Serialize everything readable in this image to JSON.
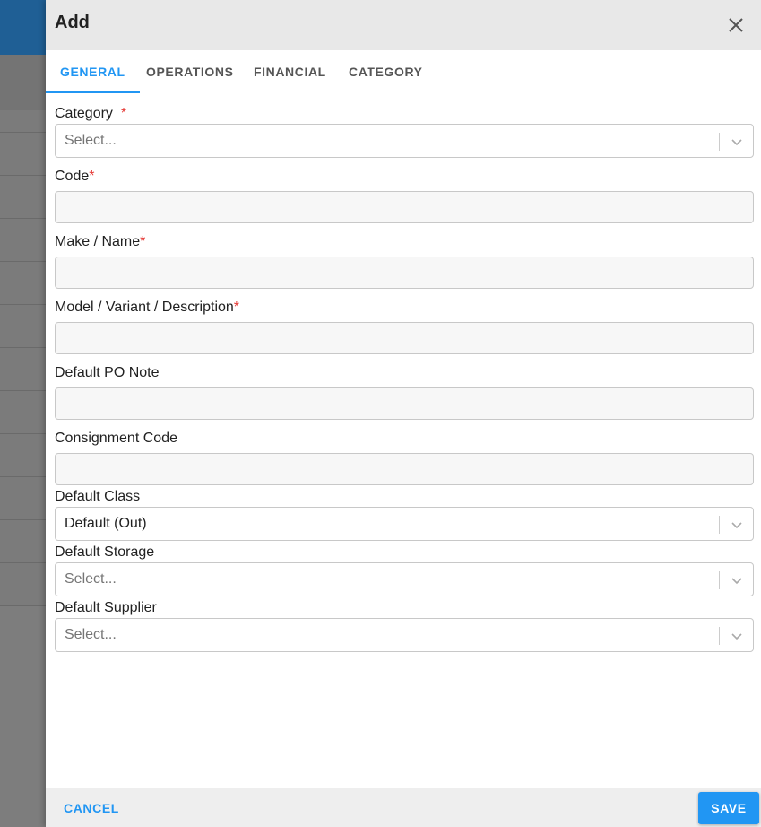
{
  "dialog": {
    "title": "Add"
  },
  "tabs": [
    {
      "label": "GENERAL",
      "active": true
    },
    {
      "label": "OPERATIONS",
      "active": false
    },
    {
      "label": "FINANCIAL",
      "active": false
    },
    {
      "label": "CATEGORY",
      "active": false
    }
  ],
  "form": {
    "category": {
      "label": "Category",
      "required_mark": "*",
      "placeholder": "Select..."
    },
    "code": {
      "label": "Code",
      "required_mark": "*",
      "value": ""
    },
    "make_name": {
      "label": "Make / Name",
      "required_mark": "*",
      "value": ""
    },
    "model": {
      "label": "Model / Variant / Description",
      "required_mark": "*",
      "value": ""
    },
    "po_note": {
      "label": "Default PO Note",
      "value": ""
    },
    "consignment": {
      "label": "Consignment Code",
      "value": ""
    },
    "default_class": {
      "label": "Default Class",
      "value": "Default (Out)"
    },
    "default_storage": {
      "label": "Default Storage",
      "placeholder": "Select..."
    },
    "default_supplier": {
      "label": "Default Supplier",
      "placeholder": "Select..."
    }
  },
  "footer": {
    "cancel_label": "CANCEL",
    "save_label": "SAVE"
  },
  "colors": {
    "accent": "#2196f3",
    "required": "#e53935",
    "app_bar": "#1f5f95"
  }
}
